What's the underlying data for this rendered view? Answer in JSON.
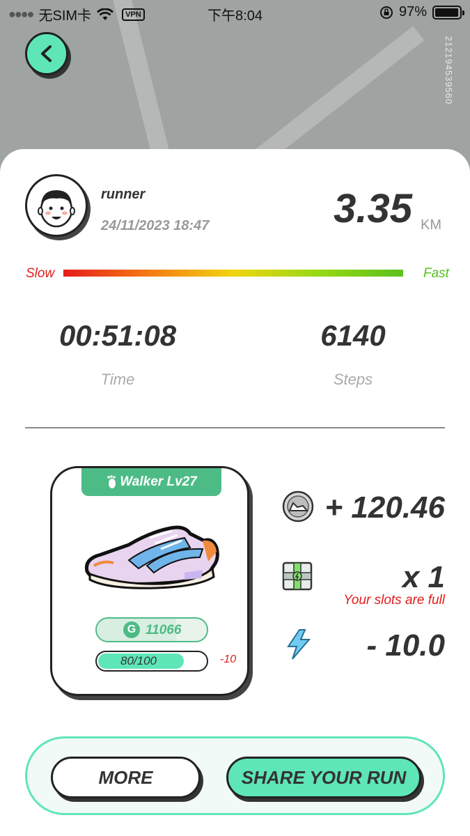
{
  "status_bar": {
    "carrier": "无SIM卡",
    "vpn": "VPN",
    "time": "下午8:04",
    "battery": "97%",
    "battery_level": 0.97
  },
  "side_id": "2121945395​60",
  "user": {
    "name": "runner",
    "datetime": "24/11/2023 18:47"
  },
  "distance": {
    "value": "3.35",
    "unit": "KM"
  },
  "speed_bar": {
    "slow_label": "Slow",
    "fast_label": "Fast"
  },
  "stats": {
    "time_value": "00:51:08",
    "time_label": "Time",
    "steps_value": "6140",
    "steps_label": "Steps"
  },
  "shoe": {
    "tag": "Walker Lv27",
    "points_icon": "G",
    "points": "11066",
    "durability": "80/100",
    "durability_level": 0.8,
    "durability_delta": "-10"
  },
  "rewards": {
    "earned": "+ 120.46",
    "boxes": "x 1",
    "slots_note": "Your slots are full",
    "energy": "- 10.0"
  },
  "actions": {
    "more": "MORE",
    "share": "SHARE YOUR RUN"
  },
  "colors": {
    "accent": "#5ee6b7",
    "green": "#4dbb86",
    "warning": "#e31b1b"
  }
}
